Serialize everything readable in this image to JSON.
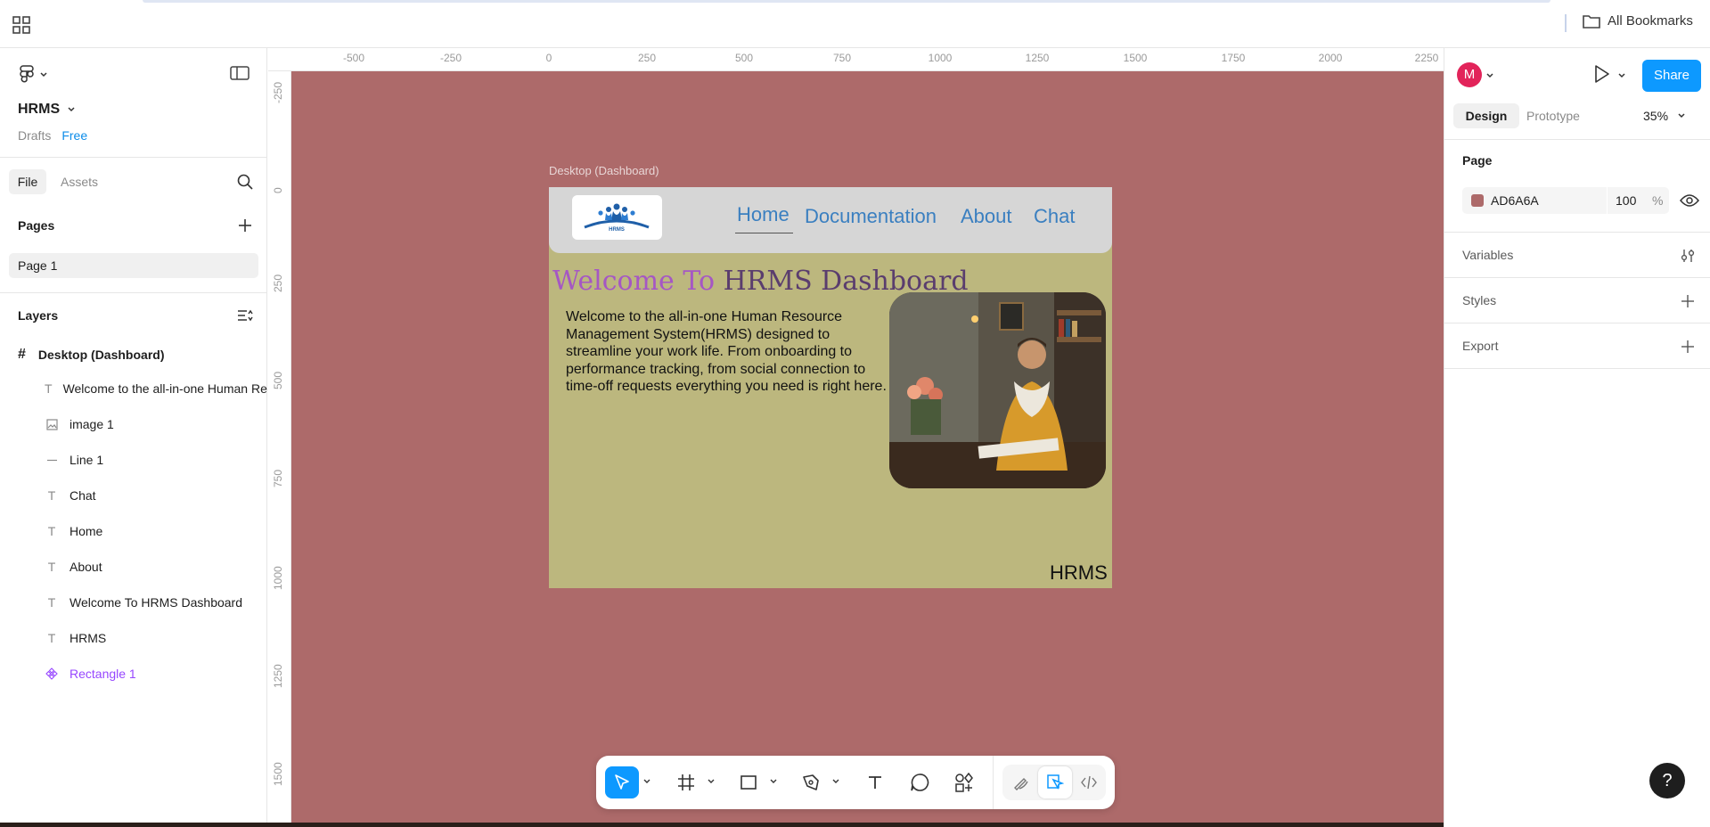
{
  "browser": {
    "bookmarks_label": "All Bookmarks"
  },
  "file": {
    "name": "HRMS",
    "location": "Drafts",
    "plan": "Free"
  },
  "left_tabs": {
    "file": "File",
    "assets": "Assets"
  },
  "pages": {
    "heading": "Pages",
    "items": [
      "Page 1"
    ]
  },
  "layers": {
    "heading": "Layers",
    "frame": "Desktop (Dashboard)",
    "items": [
      {
        "label": "Welcome to the all-in-one Human Resource Management System(HRMS) designed to",
        "icon": "text-icon"
      },
      {
        "label": "image 1",
        "icon": "image-icon"
      },
      {
        "label": "Line 1",
        "icon": "line-icon"
      },
      {
        "label": "Chat",
        "icon": "text-icon"
      },
      {
        "label": "Home",
        "icon": "text-icon"
      },
      {
        "label": "About",
        "icon": "text-icon"
      },
      {
        "label": "Welcome To HRMS Dashboard",
        "icon": "text-icon"
      },
      {
        "label": "HRMS",
        "icon": "text-icon"
      },
      {
        "label": "Rectangle 1",
        "icon": "component-icon"
      }
    ]
  },
  "ruler": {
    "horizontal": [
      "-500",
      "-250",
      "0",
      "250",
      "500",
      "750",
      "1000",
      "1250",
      "1500",
      "1750",
      "2000",
      "2250"
    ],
    "vertical": [
      "-250",
      "0",
      "250",
      "500",
      "750",
      "1000",
      "1250",
      "1500"
    ]
  },
  "canvas": {
    "background": "#AD6A6A",
    "frame_label": "Desktop (Dashboard)",
    "frame": {
      "nav": [
        "Home",
        "Documentation",
        "About",
        "Chat"
      ],
      "logo_text": "HRMS",
      "title_part1": "Welcome To ",
      "title_part2": "HRMS Dashboard",
      "body": "Welcome to the all-in-one Human Resource Management System(HRMS) designed to streamline your work life. From onboarding to performance tracking, from social connection to time-off requests everything you need is right here.",
      "brand": "HRMS",
      "background": "#BCB77E"
    }
  },
  "right_panel": {
    "avatar_initial": "M",
    "share": "Share",
    "tabs": {
      "design": "Design",
      "prototype": "Prototype"
    },
    "zoom": "35%",
    "page_section": "Page",
    "page_color_hex": "AD6A6A",
    "page_opacity": "100",
    "page_opacity_unit": "%",
    "sections": [
      "Variables",
      "Styles",
      "Export"
    ],
    "help": "?"
  },
  "colors": {
    "accent": "#0D99FF",
    "component": "#9747FF"
  }
}
